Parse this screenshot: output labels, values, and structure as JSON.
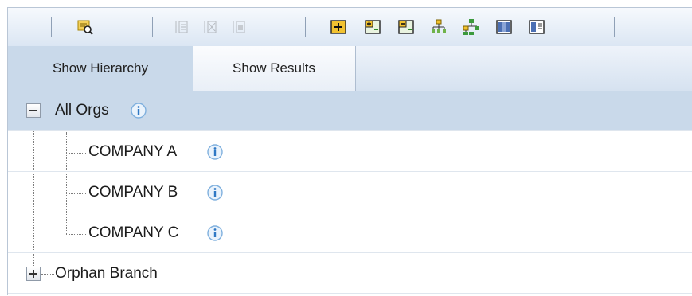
{
  "toolbar": {
    "buttons": [
      {
        "icon": "find-in-report-icon",
        "enabled": true
      },
      {
        "icon": "move-up-icon",
        "enabled": false
      },
      {
        "icon": "move-cut-icon",
        "enabled": false
      },
      {
        "icon": "move-down-icon",
        "enabled": false
      },
      {
        "icon": "add-node-icon",
        "enabled": true
      },
      {
        "icon": "expand-all-icon",
        "enabled": true
      },
      {
        "icon": "collapse-all-icon",
        "enabled": true
      },
      {
        "icon": "hierarchy-icon",
        "enabled": true
      },
      {
        "icon": "org-chart-icon",
        "enabled": true
      },
      {
        "icon": "columns-icon",
        "enabled": true
      },
      {
        "icon": "table-icon",
        "enabled": true
      }
    ],
    "accent": "#e8a900"
  },
  "tabs": [
    {
      "label": "Show Hierarchy",
      "active": true
    },
    {
      "label": "Show Results",
      "active": false
    }
  ],
  "tree": {
    "root": {
      "label": "All Orgs",
      "expanded": true
    },
    "children": [
      {
        "label": "COMPANY A"
      },
      {
        "label": "COMPANY B"
      },
      {
        "label": "COMPANY C"
      }
    ],
    "orphan": {
      "label": "Orphan Branch",
      "expanded": false
    }
  },
  "colors": {
    "selected_row": "#c9d9ea",
    "toolbar_bg": "#dbe6f3",
    "info_icon": "#4a90d0"
  }
}
